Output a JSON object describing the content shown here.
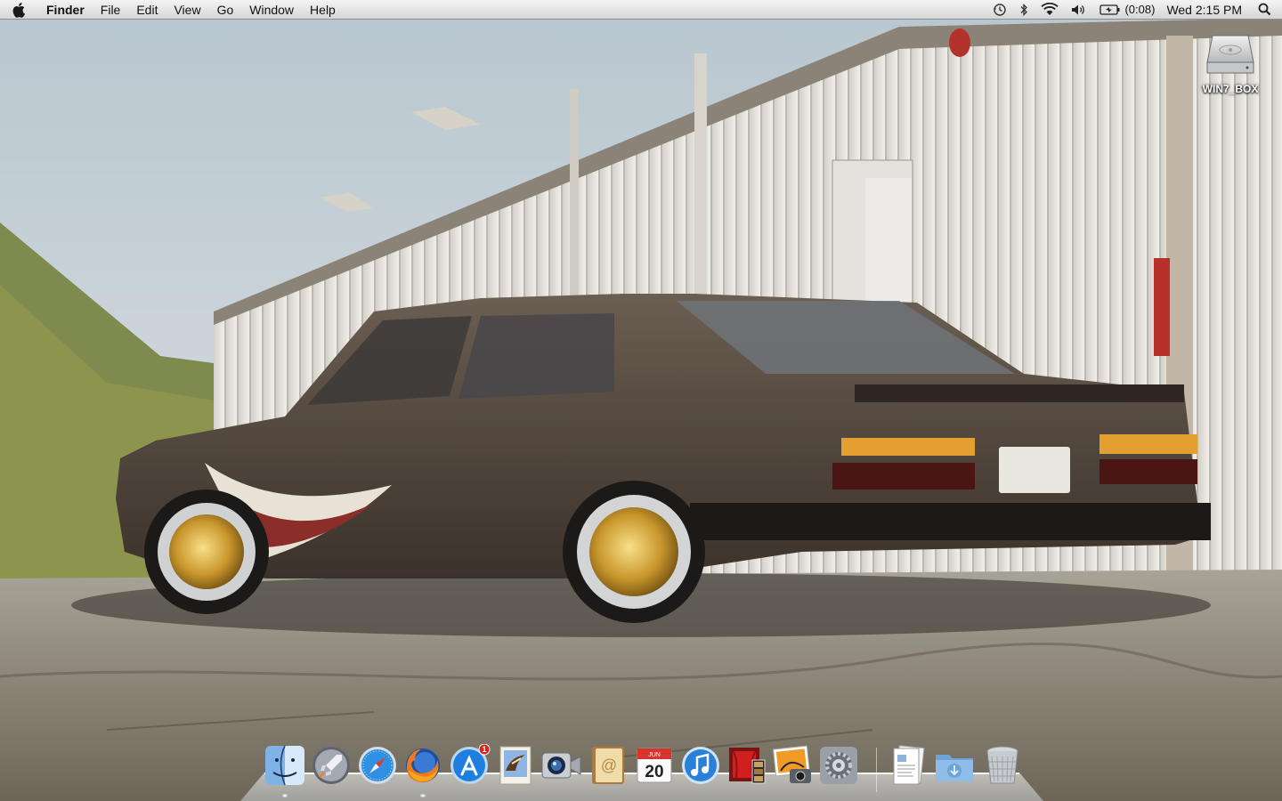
{
  "menubar": {
    "app_name": "Finder",
    "menus": [
      "File",
      "Edit",
      "View",
      "Go",
      "Window",
      "Help"
    ],
    "status": {
      "battery_time": "(0:08)",
      "clock": "Wed 2:15 PM"
    }
  },
  "desktop": {
    "icons": [
      {
        "label": "WIN7_BOX",
        "icon": "hard-drive-icon"
      }
    ],
    "wallpaper": "rusty-bmw-sedan-photo"
  },
  "dock": {
    "items": [
      {
        "icon": "finder-icon",
        "running": true
      },
      {
        "icon": "launchpad-icon",
        "running": false
      },
      {
        "icon": "safari-icon",
        "running": false
      },
      {
        "icon": "firefox-icon",
        "running": true
      },
      {
        "icon": "app-store-icon",
        "running": false,
        "badge": "1"
      },
      {
        "icon": "mail-icon",
        "running": false
      },
      {
        "icon": "facetime-icon",
        "running": false
      },
      {
        "icon": "address-book-icon",
        "running": false
      },
      {
        "icon": "ical-icon",
        "running": false,
        "month": "JUN",
        "day": "20"
      },
      {
        "icon": "itunes-icon",
        "running": false
      },
      {
        "icon": "photo-booth-icon",
        "running": false
      },
      {
        "icon": "iphoto-icon",
        "running": false
      },
      {
        "icon": "system-preferences-icon",
        "running": false
      },
      {
        "icon": "documents-stack-icon",
        "running": false
      },
      {
        "icon": "downloads-folder-icon",
        "running": false
      },
      {
        "icon": "trash-icon",
        "running": false
      }
    ]
  },
  "colors": {
    "menubar_top": "#f4f4f4",
    "menubar_bottom": "#d6d6d6",
    "badge": "#e0201c"
  }
}
